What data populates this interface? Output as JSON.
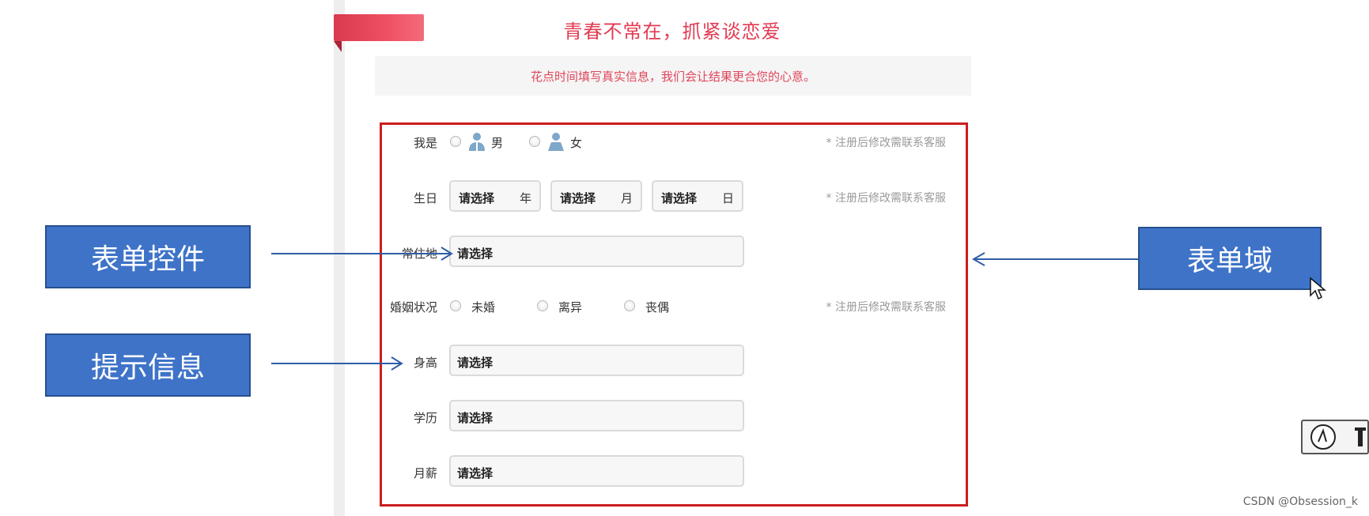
{
  "header": {
    "title": "青春不常在，抓紧谈恋爱",
    "notice": "花点时间填写真实信息，我们会让结果更合您的心意。"
  },
  "form": {
    "gender": {
      "label": "我是",
      "options": [
        "男",
        "女"
      ],
      "hint": "* 注册后修改需联系客服"
    },
    "birthday": {
      "label": "生日",
      "selects": [
        {
          "value": "请选择",
          "unit": "年"
        },
        {
          "value": "请选择",
          "unit": "月"
        },
        {
          "value": "请选择",
          "unit": "日"
        }
      ],
      "hint": "* 注册后修改需联系客服"
    },
    "residence": {
      "label": "常住地",
      "value": "请选择"
    },
    "marital": {
      "label": "婚姻状况",
      "options": [
        "未婚",
        "离异",
        "丧偶"
      ],
      "hint": "* 注册后修改需联系客服"
    },
    "height": {
      "label": "身高",
      "value": "请选择"
    },
    "education": {
      "label": "学历",
      "value": "请选择"
    },
    "salary": {
      "label": "月薪",
      "value": "请选择"
    }
  },
  "annotations": {
    "form_control": "表单控件",
    "hint_info": "提示信息",
    "form_field": "表单域"
  },
  "colors": {
    "accent": "#e23b52",
    "frame": "#cc1d1d",
    "callout_bg": "#3e73c8",
    "arrow": "#2f5da8"
  },
  "watermark": "CSDN @Obsession_k"
}
